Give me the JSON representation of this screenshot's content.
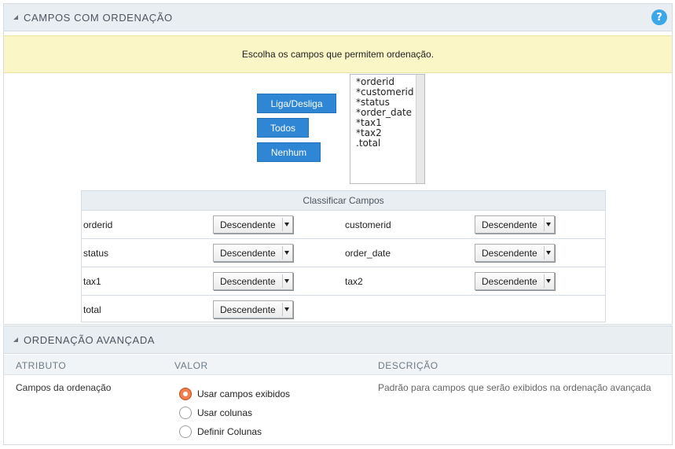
{
  "section1": {
    "title": "CAMPOS COM ORDENAÇÃO",
    "help": "?",
    "notice": "Escolha os campos que permitem ordenação.",
    "buttons": {
      "toggle": "Liga/Desliga",
      "all": "Todos",
      "none": "Nenhum"
    },
    "list_items": [
      "*orderid",
      "*customerid",
      "*status",
      "*order_date",
      "*tax1",
      "*tax2",
      ".total"
    ],
    "sort_table": {
      "title": "Classificar Campos",
      "rows": [
        {
          "left_label": "orderid",
          "left_value": "Descendente",
          "right_label": "customerid",
          "right_value": "Descendente"
        },
        {
          "left_label": "status",
          "left_value": "Descendente",
          "right_label": "order_date",
          "right_value": "Descendente"
        },
        {
          "left_label": "tax1",
          "left_value": "Descendente",
          "right_label": "tax2",
          "right_value": "Descendente"
        },
        {
          "left_label": "total",
          "left_value": "Descendente",
          "right_label": "",
          "right_value": ""
        }
      ]
    }
  },
  "section2": {
    "title": "ORDENAÇÃO AVANÇADA",
    "columns": {
      "attribute": "ATRIBUTO",
      "value": "VALOR",
      "description": "DESCRIÇÃO"
    },
    "attribute": "Campos da ordenação",
    "options": [
      {
        "label": "Usar campos exibidos",
        "checked": true
      },
      {
        "label": "Usar colunas",
        "checked": false
      },
      {
        "label": "Definir Colunas",
        "checked": false
      }
    ],
    "description": "Padrão para campos que serão exibidos na ordenação avançada"
  },
  "colors": {
    "accent": "#2f86d4",
    "help": "#3ba6e8",
    "notice_bg": "#fbf6c6",
    "radio_checked": "#f08050"
  }
}
